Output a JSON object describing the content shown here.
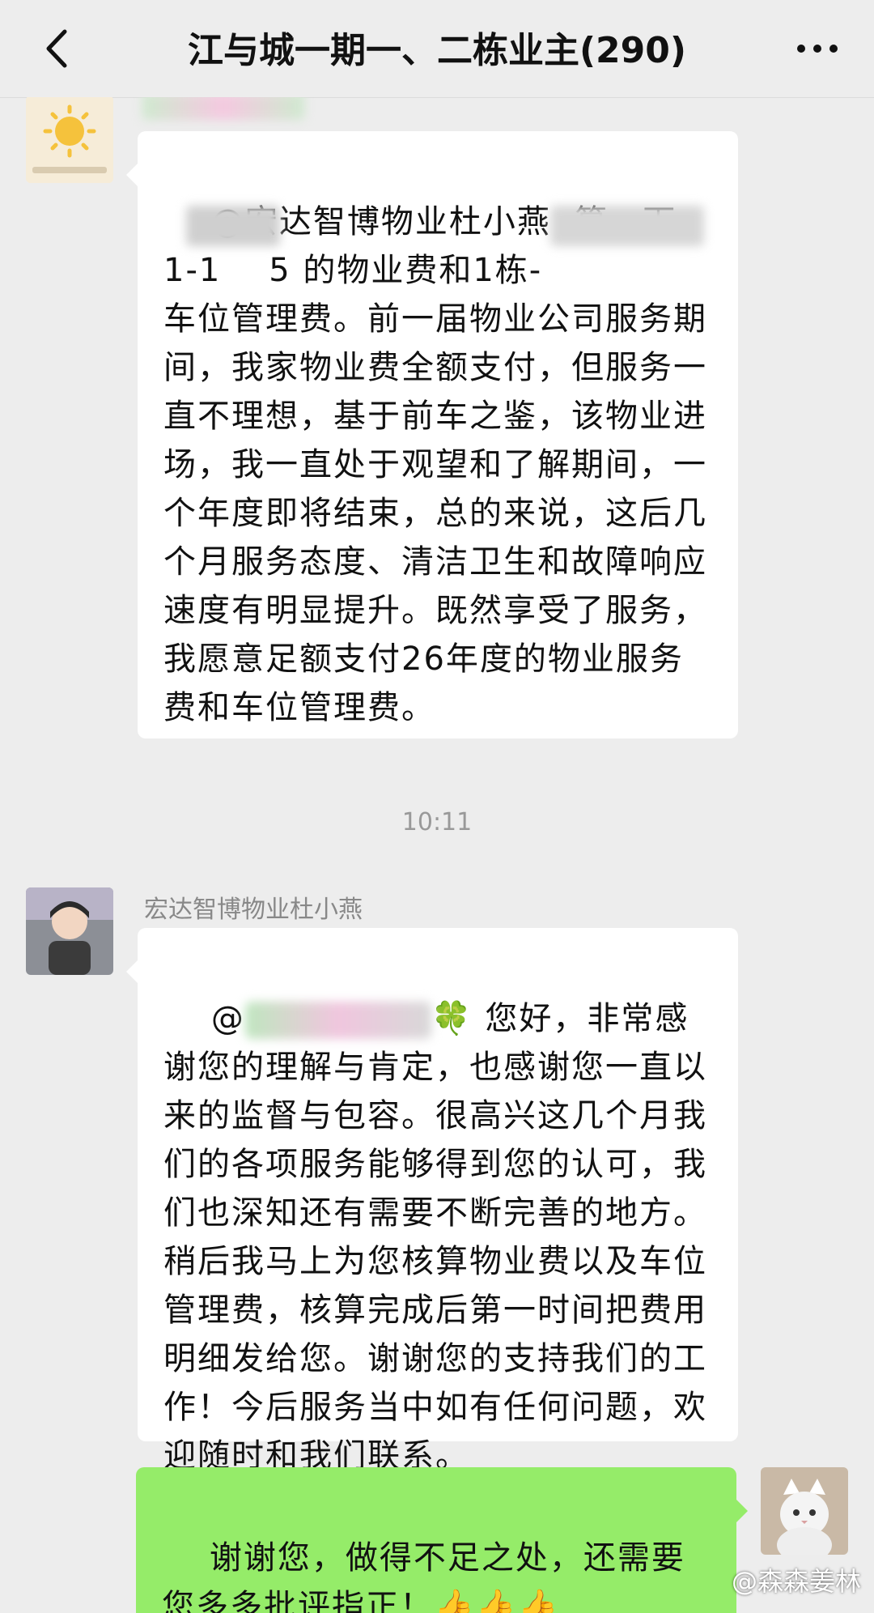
{
  "header": {
    "title": "江与城一期一、二栋业主(290)",
    "back_icon": "chevron-left-icon",
    "more_icon": "ellipsis-icon"
  },
  "messages": [
    {
      "direction": "incoming",
      "sender_name": "",
      "text": "@宏达智博物业杜小燕  算一下\n1-1    5 的物业费和1栋-              \n车位管理费。前一届物业公司服务期间，我家物业费全额支付，但服务一直不理想，基于前车之鉴，该物业进场，我一直处于观望和了解期间，一个年度即将结束，总的来说，这后几个月服务态度、清洁卫生和故障响应速度有明显提升。既然享受了服务，我愿意足额支付26年度的物业服务费和车位管理费。"
    },
    {
      "type": "timestamp",
      "text": "10:11"
    },
    {
      "direction": "incoming",
      "sender_name": "宏达智博物业杜小燕",
      "mention": "@",
      "emoji": "🍀",
      "text": "您好，非常感谢您的理解与肯定，也感谢您一直以来的监督与包容。很高兴这几个月我们的各项服务能够得到您的认可，我们也深知还有需要不断完善的地方。稍后我马上为您核算物业费以及车位管理费，核算完成后第一时间把费用明细发给您。谢谢您的支持我们的工作！今后服务当中如有任何问题，欢迎随时和我们联系。"
    },
    {
      "direction": "outgoing",
      "text": "谢谢您，做得不足之处，还需要您多多批评指正！",
      "emoji": "👍👍👍"
    }
  ],
  "watermark": "@森森姜林",
  "colors": {
    "background": "#ededed",
    "incoming_bubble": "#ffffff",
    "outgoing_bubble": "#95ec69",
    "sender_name": "#888888"
  }
}
